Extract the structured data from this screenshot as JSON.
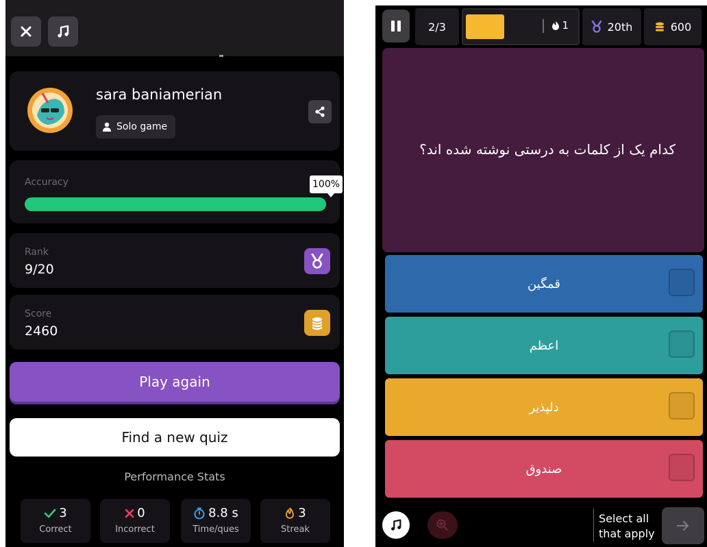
{
  "results": {
    "player_name": "sara baniamerian",
    "mode_label": "Solo game",
    "accuracy_label": "Accuracy",
    "accuracy_value": "100%",
    "accuracy_fraction": 1.0,
    "rank_label": "Rank",
    "rank_value": "9/20",
    "score_label": "Score",
    "score_value": "2460",
    "play_again_label": "Play again",
    "find_quiz_label": "Find a new quiz",
    "stats_heading": "Performance Stats",
    "stats": [
      {
        "value": "3",
        "label": "Correct",
        "icon": "check-icon",
        "color": "#2fd07a"
      },
      {
        "value": "0",
        "label": "Incorrect",
        "icon": "cross-icon",
        "color": "#f0405a"
      },
      {
        "value": "8.8 s",
        "label": "Time/ques",
        "icon": "stopwatch-icon",
        "color": "#38a3e8"
      },
      {
        "value": "3",
        "label": "Streak",
        "icon": "flame-icon",
        "color": "#f0a830"
      }
    ]
  },
  "quiz": {
    "question_counter": "2/3",
    "streak_count": "1",
    "rank": "20th",
    "coins": "600",
    "question": "کدام یک از کلمات به درستی نوشته شده اند؟",
    "options": [
      {
        "text": "قمگین",
        "color": "#2d69ab"
      },
      {
        "text": "اعظم",
        "color": "#2e9e9d"
      },
      {
        "text": "دلپذیر",
        "color": "#e8a92c"
      },
      {
        "text": "صندوق",
        "color": "#d24b63"
      }
    ],
    "select_all_line1": "Select all",
    "select_all_line2": "that apply"
  },
  "colors": {
    "accent_purple": "#8752c2",
    "accuracy_bar": "#1fc77a",
    "question_bg": "#451c3d",
    "timer_bar": "#f5b82e"
  }
}
